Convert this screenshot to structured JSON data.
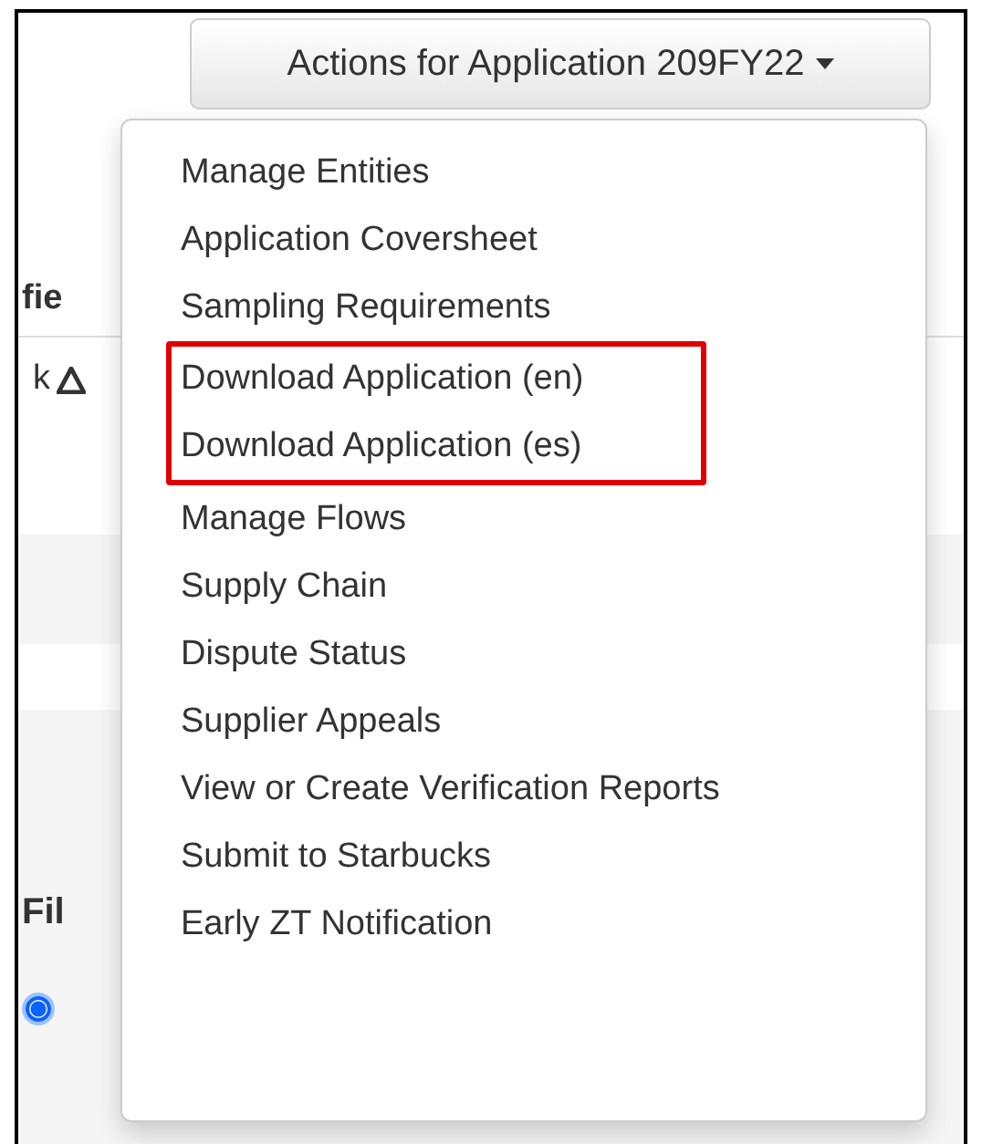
{
  "background": {
    "heading": "fie",
    "row_text": "k",
    "section_heading": "Fil",
    "radio": {
      "selected": true
    }
  },
  "actions_button": {
    "label": "Actions for Application 209FY22"
  },
  "menu": {
    "items": [
      {
        "label": "Manage Entities",
        "highlighted": false
      },
      {
        "label": "Application Coversheet",
        "highlighted": false
      },
      {
        "label": "Sampling Requirements",
        "highlighted": false
      },
      {
        "label": "Download Application (en)",
        "highlighted": true
      },
      {
        "label": "Download Application (es)",
        "highlighted": true
      },
      {
        "label": "Manage Flows",
        "highlighted": false
      },
      {
        "label": "Supply Chain",
        "highlighted": false
      },
      {
        "label": "Dispute Status",
        "highlighted": false
      },
      {
        "label": "Supplier Appeals",
        "highlighted": false
      },
      {
        "label": "View or Create Verification Reports",
        "highlighted": false
      },
      {
        "label": "Submit to Starbucks",
        "highlighted": false
      },
      {
        "label": "Early ZT Notification",
        "highlighted": false
      }
    ]
  }
}
